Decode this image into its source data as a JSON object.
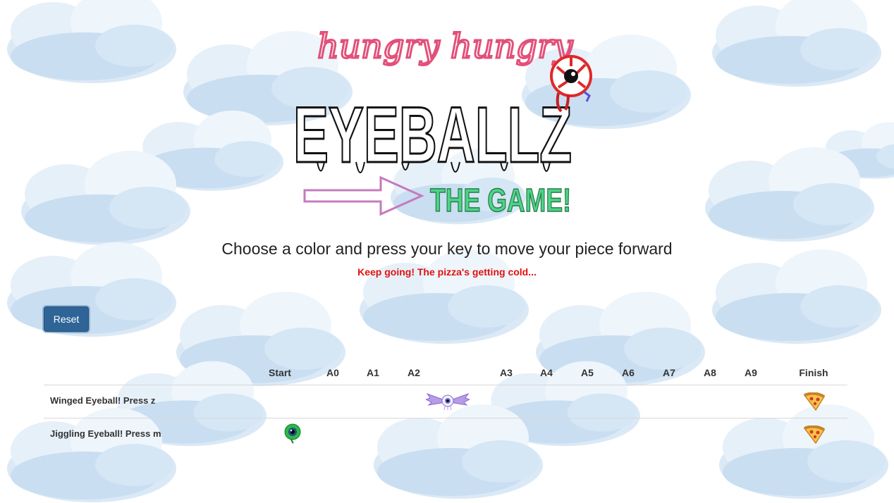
{
  "logo": {
    "line1": "hungry hungry",
    "line2": "EYEBALLZ",
    "line3": "THE GAME!"
  },
  "instructions": "Choose a color and press your key to move your piece forward",
  "status": "Keep going! The pizza's getting cold...",
  "reset_label": "Reset",
  "track": {
    "columns": [
      "Start",
      "A0",
      "A1",
      "A2",
      "A3",
      "A4",
      "A5",
      "A6",
      "A7",
      "A8",
      "A9",
      "Finish"
    ],
    "players": [
      {
        "label": "Winged Eyeball! Press z",
        "piece": "winged-eyeball-icon",
        "position": "A2"
      },
      {
        "label": "Jiggling Eyeball! Press m",
        "piece": "green-eyeball-icon",
        "position": "Start"
      }
    ],
    "finish_icon": "pizza-slice-icon"
  },
  "colors": {
    "status": "#e0110e",
    "reset_button": "#2f6596",
    "logo_pink": "#e2507a",
    "logo_green": "#4cd487",
    "logo_arrow": "#c47bbf",
    "cloud": "#cfe3f3"
  }
}
